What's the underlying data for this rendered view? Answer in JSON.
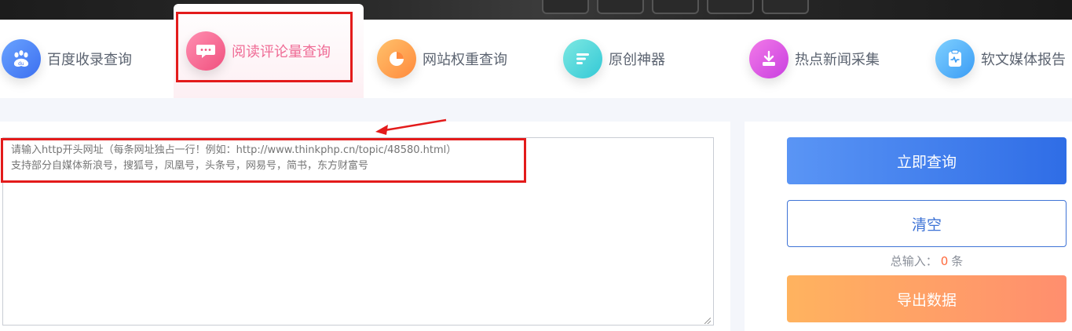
{
  "tabs": [
    {
      "label": "百度收录查询",
      "icon": "baidu-paw-icon"
    },
    {
      "label": "阅读评论量查询",
      "icon": "comment-eye-icon",
      "active": true
    },
    {
      "label": "网站权重查询",
      "icon": "pie-chart-icon"
    },
    {
      "label": "原创神器",
      "icon": "text-lines-icon"
    },
    {
      "label": "热点新闻采集",
      "icon": "download-tray-icon"
    },
    {
      "label": "软文媒体报告",
      "icon": "clipboard-pulse-icon"
    }
  ],
  "input": {
    "placeholder": "请输入http开头网址（每条网址独占一行！例如：http://www.thinkphp.cn/topic/48580.html）\n支持部分自媒体新浪号，搜狐号，凤凰号，头条号，网易号，简书，东方财富号",
    "value": ""
  },
  "actions": {
    "query_label": "立即查询",
    "clear_label": "清空",
    "export_label": "导出数据"
  },
  "total": {
    "prefix": "总输入：",
    "count": "0",
    "suffix": "条"
  },
  "colors": {
    "accent_blue": "#3e73d6",
    "active_tab_pink": "#ef6b95",
    "count_orange": "#ff6a3d",
    "highlight_red": "#e31b1b"
  }
}
